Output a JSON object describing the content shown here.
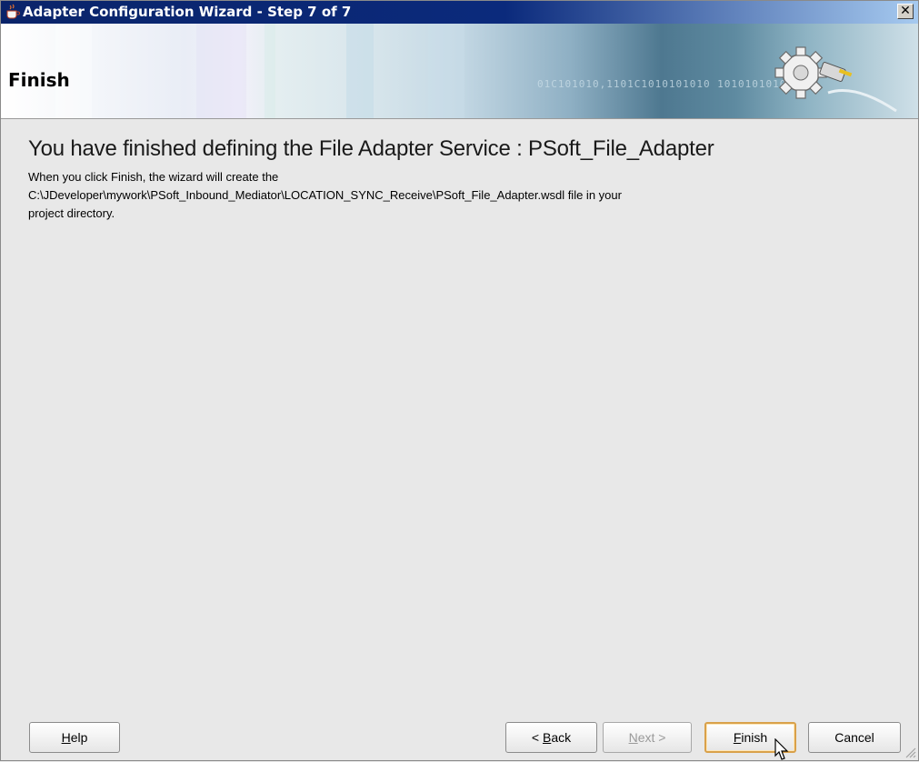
{
  "window": {
    "title": "Adapter Configuration Wizard - Step 7 of 7",
    "close_glyph": "✕"
  },
  "banner": {
    "title": "Finish",
    "bits": "01C101010,1101C1010101010 1010101010101"
  },
  "content": {
    "heading": "You have finished defining the File Adapter Service : PSoft_File_Adapter",
    "line1": "When you click Finish, the wizard will create the",
    "line2": "C:\\JDeveloper\\mywork\\PSoft_Inbound_Mediator\\LOCATION_SYNC_Receive\\PSoft_File_Adapter.wsdl file in your",
    "line3": "project directory."
  },
  "buttons": {
    "help": {
      "pre": "",
      "mn": "H",
      "post": "elp"
    },
    "back": {
      "pre": "< ",
      "mn": "B",
      "post": "ack"
    },
    "next": {
      "pre": "",
      "mn": "N",
      "post": "ext >"
    },
    "finish": {
      "pre": "",
      "mn": "F",
      "post": "inish"
    },
    "cancel": {
      "label": "Cancel"
    }
  },
  "icons": {
    "title": "coffee-cup-icon",
    "banner": "gear-plug-icon",
    "close": "close-icon"
  }
}
